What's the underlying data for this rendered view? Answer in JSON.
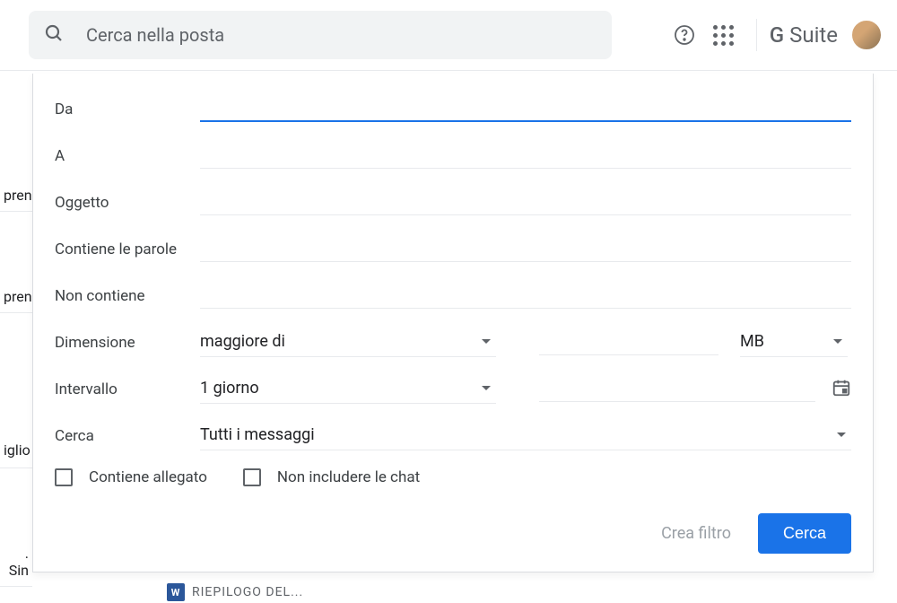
{
  "header": {
    "search_placeholder": "Cerca nella posta",
    "gsuite_label": "G Suite"
  },
  "sidebar": {
    "items": [
      "pren",
      "pren",
      "iglio",
      ". Sin"
    ]
  },
  "form": {
    "from_label": "Da",
    "to_label": "A",
    "subject_label": "Oggetto",
    "has_words_label": "Contiene le parole",
    "not_has_label": "Non contiene",
    "size_label": "Dimensione",
    "size_operator": "maggiore di",
    "size_unit": "MB",
    "interval_label": "Intervallo",
    "interval_value": "1 giorno",
    "search_label": "Cerca",
    "search_value": "Tutti i messaggi",
    "has_attachment_label": "Contiene allegato",
    "exclude_chat_label": "Non includere le chat"
  },
  "footer": {
    "create_filter": "Crea filtro",
    "search_button": "Cerca"
  },
  "background": {
    "chip_text": "RIEPILOGO DEL...",
    "chip_icon": "W"
  }
}
